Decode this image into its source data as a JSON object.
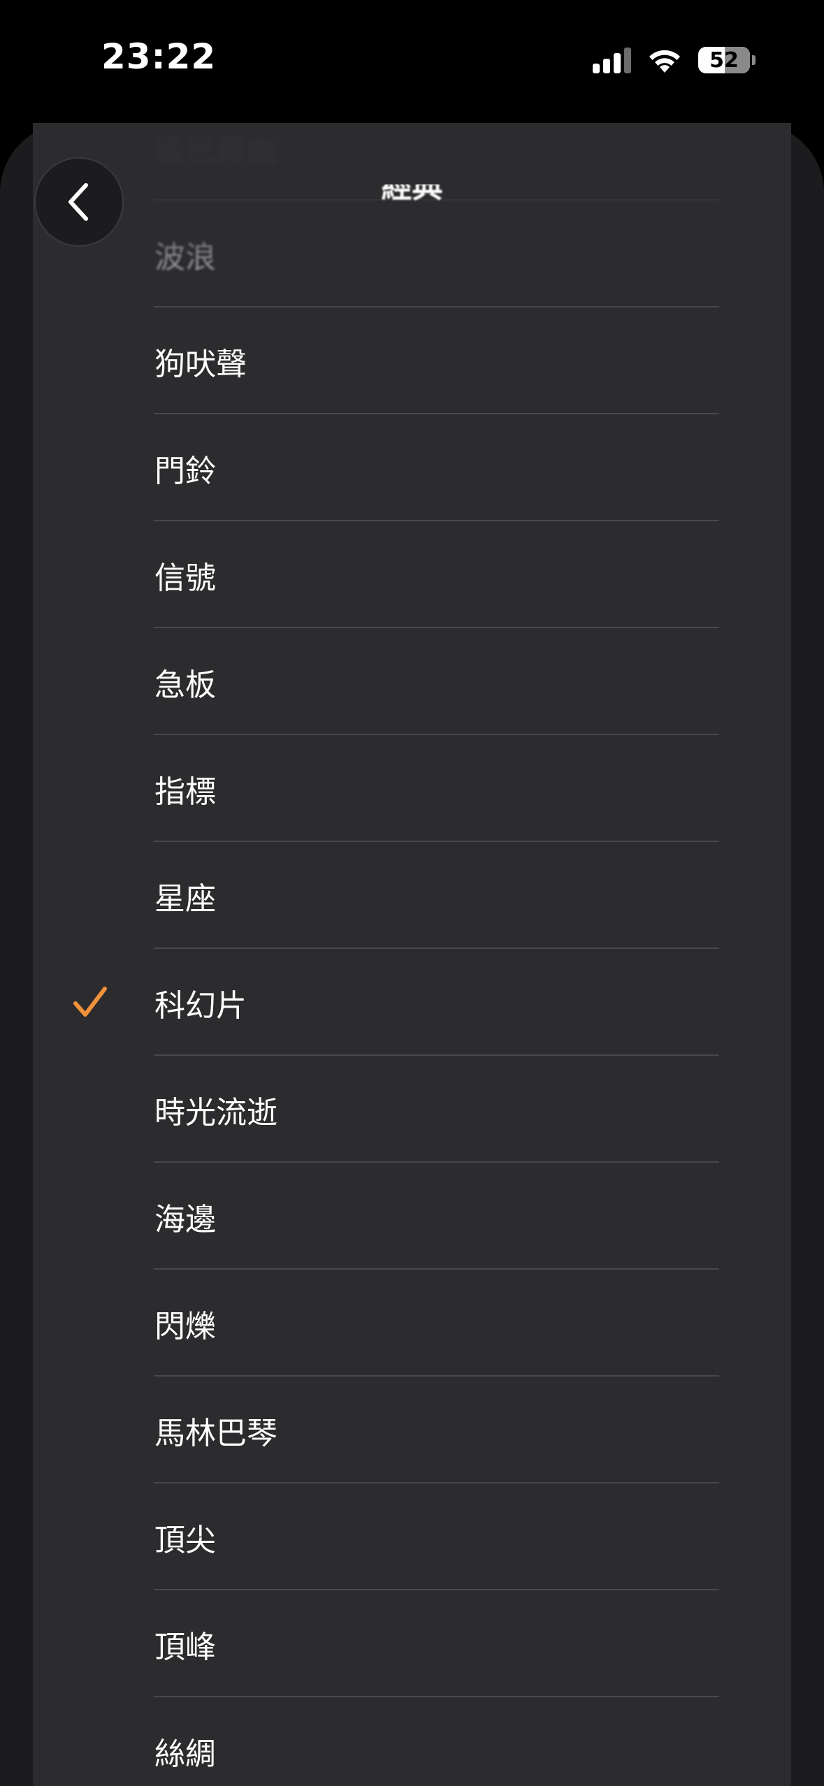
{
  "status_bar": {
    "time": "23:22",
    "battery": "52"
  },
  "nav": {
    "title": "經典",
    "back_icon": "chevron-left-icon"
  },
  "list": {
    "items": [
      {
        "label": "碰巴舞曲",
        "selected": false
      },
      {
        "label": "波浪",
        "selected": false
      },
      {
        "label": "狗吠聲",
        "selected": false
      },
      {
        "label": "門鈴",
        "selected": false
      },
      {
        "label": "信號",
        "selected": false
      },
      {
        "label": "急板",
        "selected": false
      },
      {
        "label": "指標",
        "selected": false
      },
      {
        "label": "星座",
        "selected": false
      },
      {
        "label": "科幻片",
        "selected": true
      },
      {
        "label": "時光流逝",
        "selected": false
      },
      {
        "label": "海邊",
        "selected": false
      },
      {
        "label": "閃爍",
        "selected": false
      },
      {
        "label": "馬林巴琴",
        "selected": false
      },
      {
        "label": "頂尖",
        "selected": false
      },
      {
        "label": "頂峰",
        "selected": false
      },
      {
        "label": "絲綢",
        "selected": false
      }
    ]
  },
  "colors": {
    "accent": "#f0913b",
    "sheet": "#2c2c2e",
    "divider": "#48484a"
  }
}
